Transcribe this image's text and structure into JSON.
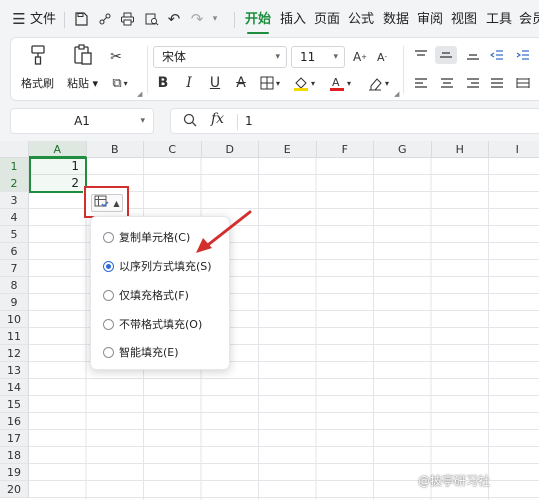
{
  "menubar": {
    "file_label": "文件",
    "tabs": [
      "开始",
      "插入",
      "页面",
      "公式",
      "数据",
      "审阅",
      "视图",
      "工具",
      "会员"
    ],
    "active_tab": "开始"
  },
  "ribbon": {
    "format_painter": "格式刷",
    "paste": "粘贴",
    "font_name": "宋体",
    "font_size": "11"
  },
  "formula_bar": {
    "name_box": "A1",
    "fx": "fx",
    "value": "1"
  },
  "sheet": {
    "columns": [
      "A",
      "B",
      "C",
      "D",
      "E",
      "F",
      "G",
      "H",
      "I"
    ],
    "rows": [
      "1",
      "2",
      "3",
      "4",
      "5",
      "6",
      "7",
      "8",
      "9",
      "10",
      "11",
      "12",
      "13",
      "14",
      "15",
      "16",
      "17",
      "18",
      "19",
      "20"
    ],
    "cells": {
      "A1": "1",
      "A2": "2"
    }
  },
  "autofill_menu": {
    "options": [
      {
        "label": "复制单元格(C)",
        "selected": false
      },
      {
        "label": "以序列方式填充(S)",
        "selected": true
      },
      {
        "label": "仅填充格式(F)",
        "selected": false
      },
      {
        "label": "不带格式填充(O)",
        "selected": false
      },
      {
        "label": "智能填充(E)",
        "selected": false
      }
    ]
  },
  "watermark": "@披亭研习社",
  "colors": {
    "accent": "#1e8e3e",
    "highlight_red": "#d32f2f",
    "radio_blue": "#2f6bd6"
  }
}
